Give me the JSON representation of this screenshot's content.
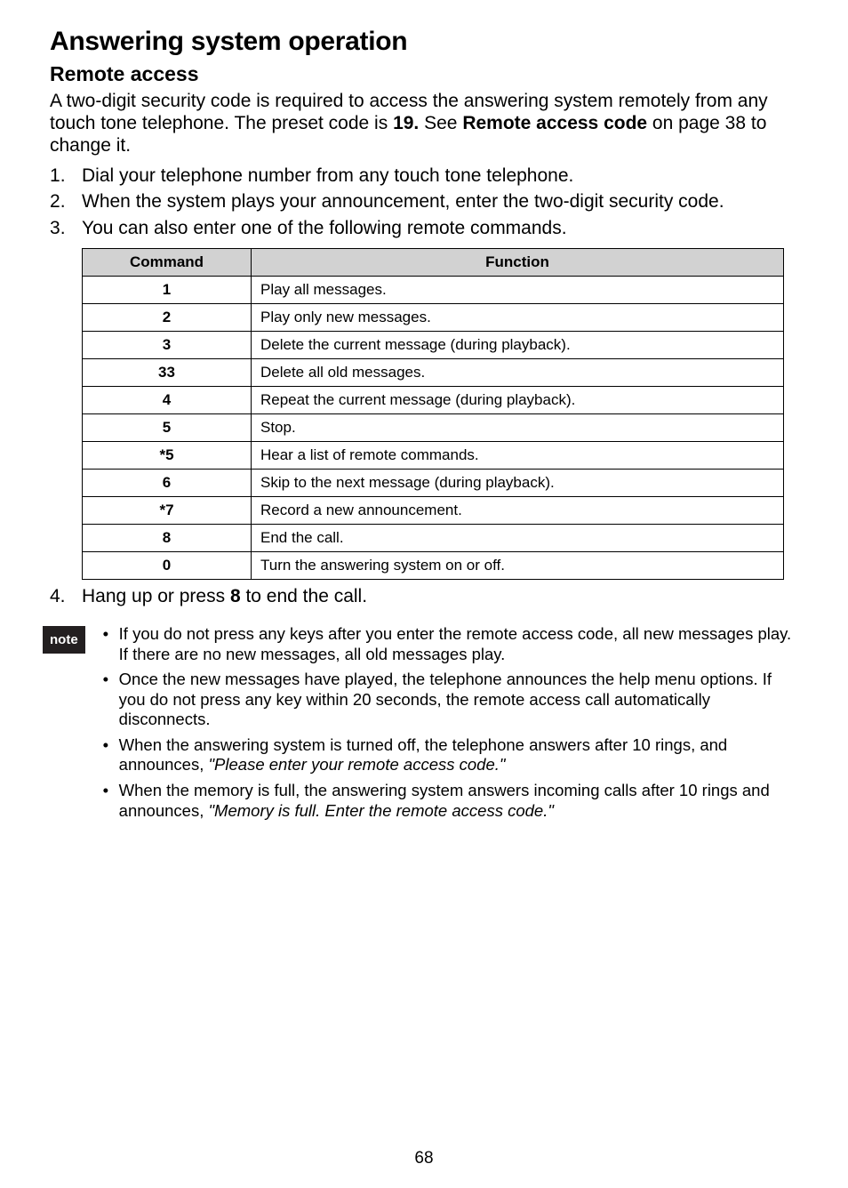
{
  "heading": "Answering system operation",
  "subheading": "Remote access",
  "intro_parts": {
    "p1": "A two-digit security code is required to access the answering system remotely from any touch tone telephone. The preset code is ",
    "code": "19.",
    "p2": " See ",
    "bold2": "Remote access code",
    "p3": " on page 38 to change it."
  },
  "steps": [
    "Dial your telephone number from any touch tone telephone.",
    "When the system plays your announcement, enter the two-digit security code.",
    "You can also enter one of the following remote commands."
  ],
  "table": {
    "headers": {
      "command": "Command",
      "function": "Function"
    },
    "rows": [
      {
        "command": "1",
        "function": "Play all messages."
      },
      {
        "command": "2",
        "function": "Play only new messages."
      },
      {
        "command": "3",
        "function": "Delete the current message (during playback)."
      },
      {
        "command": "33",
        "function": "Delete all old messages."
      },
      {
        "command": "4",
        "function": "Repeat the current message (during playback)."
      },
      {
        "command": "5",
        "function": "Stop."
      },
      {
        "command": "*5",
        "function": "Hear a list of remote commands."
      },
      {
        "command": "6",
        "function": "Skip to the next message (during playback)."
      },
      {
        "command": "*7",
        "function": "Record a new announcement."
      },
      {
        "command": "8",
        "function": "End the call."
      },
      {
        "command": "0",
        "function": "Turn the answering system on or off."
      }
    ]
  },
  "step4": {
    "num": "4.",
    "pre": "Hang up or press ",
    "bold": "8",
    "post": " to end the call."
  },
  "note_label": "note",
  "notes": [
    {
      "text": "If you do not press any keys after you enter the remote access code, all new messages play. If there are no new messages, all old messages play."
    },
    {
      "text": "Once the new messages have played, the telephone announces the help menu options. If you do not press any key within 20 seconds, the remote access call automatically disconnects."
    },
    {
      "text": "When the answering system is turned off, the telephone answers after 10 rings, and announces, ",
      "italic": "\"Please enter your remote access code.\""
    },
    {
      "text": "When the memory is full, the answering system answers incoming calls after 10 rings and announces, ",
      "italic": "\"Memory is full. Enter the remote access code.\""
    }
  ],
  "page_number": "68"
}
